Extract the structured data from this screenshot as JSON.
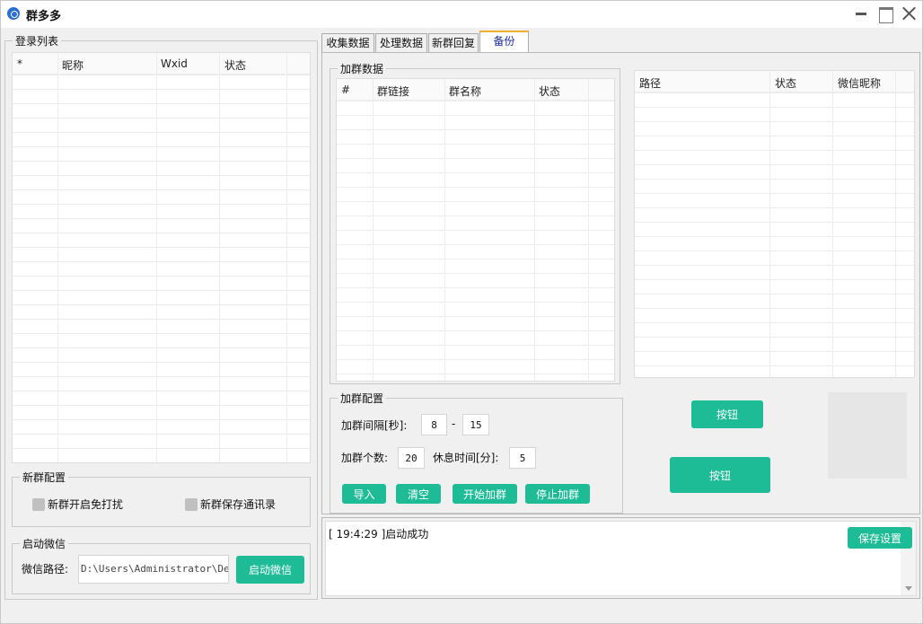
{
  "window": {
    "title": "群多多"
  },
  "login": {
    "group_label": "登录列表",
    "columns": [
      "*",
      "昵称",
      "Wxid",
      "状态"
    ]
  },
  "new_group_config": {
    "group_label": "新群配置",
    "no_disturb": "新群开启免打扰",
    "save_contacts": "新群保存通讯录"
  },
  "launch": {
    "group_label": "启动微信",
    "path_label": "微信路径:",
    "path_value": "D:\\Users\\Administrator\\Deskt",
    "launch_button": "启动微信"
  },
  "tabs": [
    "收集数据",
    "处理数据",
    "新群回复",
    "备份"
  ],
  "join_data": {
    "group_label": "加群数据",
    "columns": [
      "#",
      "群链接",
      "群名称",
      "状态"
    ]
  },
  "backup_table": {
    "columns": [
      "路径",
      "状态",
      "微信昵称"
    ]
  },
  "join_config": {
    "group_label": "加群配置",
    "interval_label": "加群间隔[秒]:",
    "interval_min": "8",
    "dash": "-",
    "interval_max": "15",
    "count_label": "加群个数:",
    "count_value": "20",
    "rest_label": "休息时间[分]:",
    "rest_value": "5",
    "import_button": "导入",
    "clear_button": "清空",
    "start_button": "开始加群",
    "stop_button": "停止加群"
  },
  "buttons": {
    "button1": "按钮",
    "button2": "按钮"
  },
  "log": {
    "line": "[ 19:4:29 ]启动成功",
    "save_button": "保存设置"
  }
}
